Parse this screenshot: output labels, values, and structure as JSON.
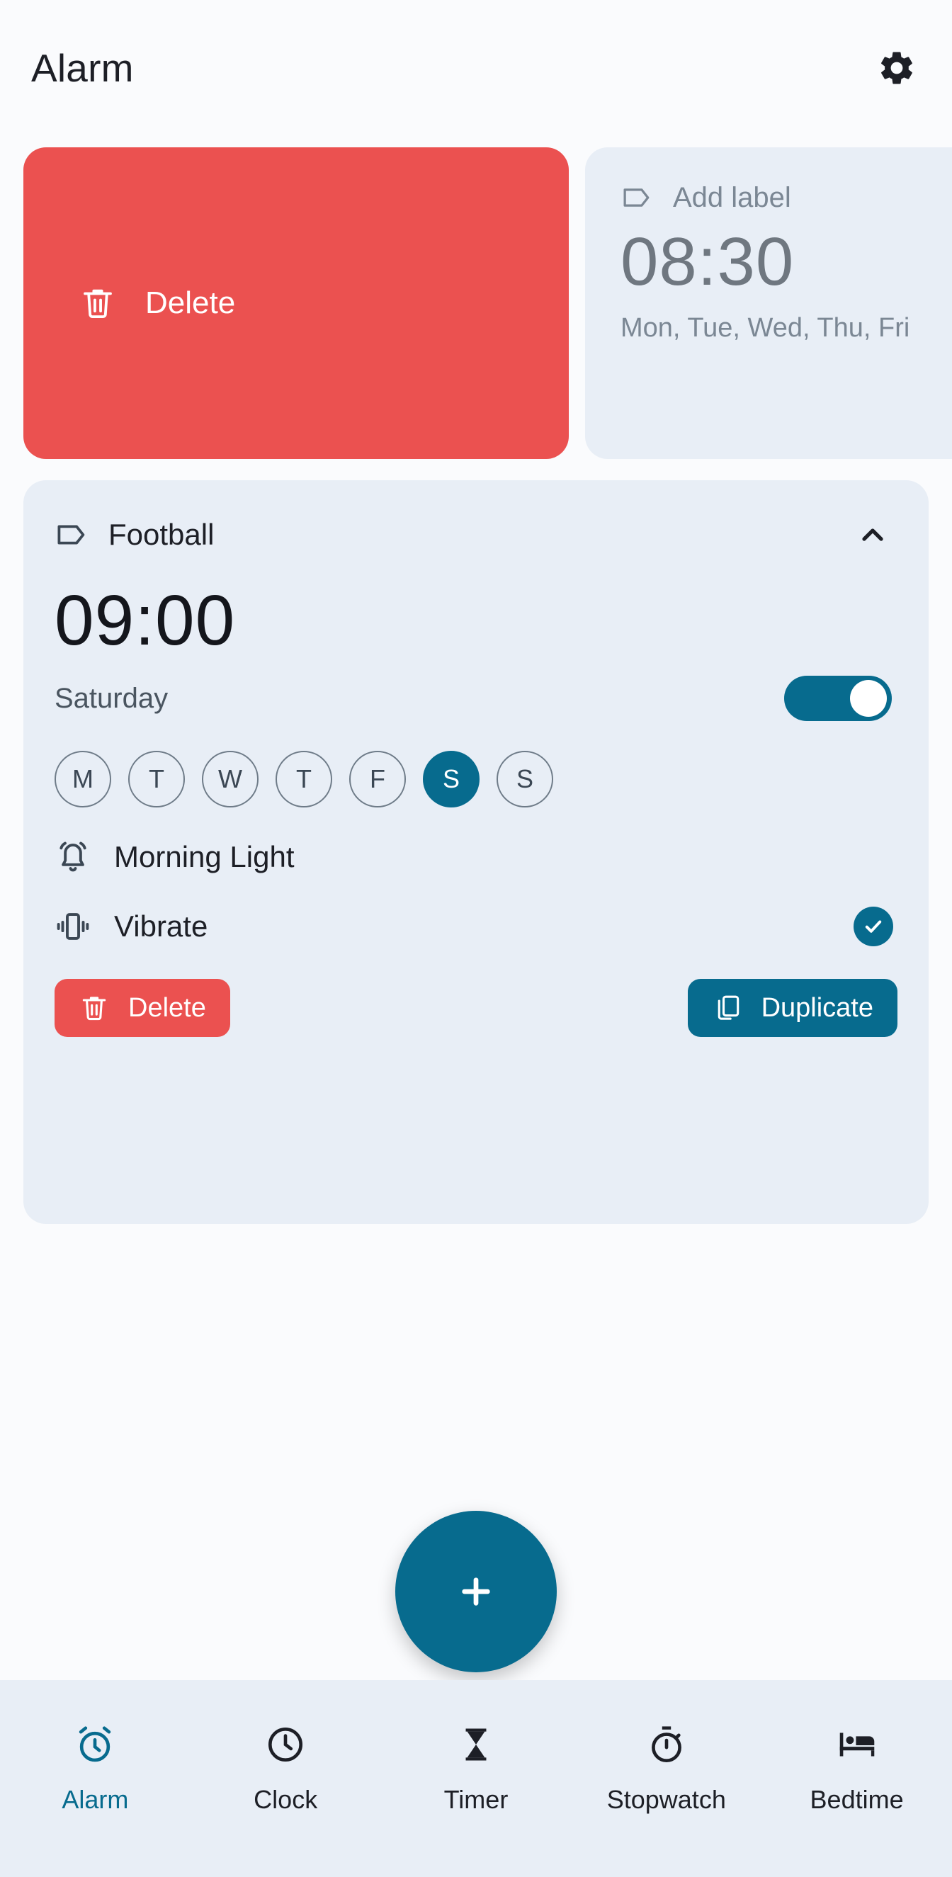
{
  "header": {
    "title": "Alarm",
    "settings_icon": "gear-icon"
  },
  "swipe_action": {
    "delete_label": "Delete",
    "delete_icon": "trash-icon",
    "background_color": "#eb5150"
  },
  "alarms": [
    {
      "label": "Add label",
      "label_icon": "tag-icon",
      "time": "08:30",
      "days_summary": "Mon, Tue, Wed, Thu, Fri",
      "enabled": false,
      "expanded": false,
      "swiped": true
    },
    {
      "label": "Football",
      "label_icon": "tag-icon",
      "collapse_icon": "chevron-up-icon",
      "time": "09:00",
      "days_summary": "Saturday",
      "enabled": true,
      "expanded": true,
      "day_toggles": [
        {
          "letter": "M",
          "name": "Monday",
          "selected": false
        },
        {
          "letter": "T",
          "name": "Tuesday",
          "selected": false
        },
        {
          "letter": "W",
          "name": "Wednesday",
          "selected": false
        },
        {
          "letter": "T",
          "name": "Thursday",
          "selected": false
        },
        {
          "letter": "F",
          "name": "Friday",
          "selected": false
        },
        {
          "letter": "S",
          "name": "Saturday",
          "selected": true
        },
        {
          "letter": "S",
          "name": "Sunday",
          "selected": false
        }
      ],
      "ringtone": {
        "label": "Morning Light",
        "icon": "alarm-bell-icon"
      },
      "vibrate": {
        "label": "Vibrate",
        "icon": "vibrate-icon",
        "checked": true,
        "check_icon": "check-icon"
      },
      "delete_button": {
        "label": "Delete",
        "icon": "trash-icon"
      },
      "duplicate_button": {
        "label": "Duplicate",
        "icon": "copy-icon"
      }
    }
  ],
  "fab": {
    "icon": "plus-icon",
    "color": "#076b8e"
  },
  "bottom_nav": {
    "items": [
      {
        "label": "Alarm",
        "icon": "alarm-clock-icon",
        "active": true
      },
      {
        "label": "Clock",
        "icon": "clock-icon",
        "active": false
      },
      {
        "label": "Timer",
        "icon": "hourglass-icon",
        "active": false
      },
      {
        "label": "Stopwatch",
        "icon": "stopwatch-icon",
        "active": false
      },
      {
        "label": "Bedtime",
        "icon": "bed-icon",
        "active": false
      }
    ]
  },
  "colors": {
    "accent": "#076b8e",
    "danger": "#eb5150",
    "card": "#e8eef6",
    "page": "#fafbfd"
  }
}
